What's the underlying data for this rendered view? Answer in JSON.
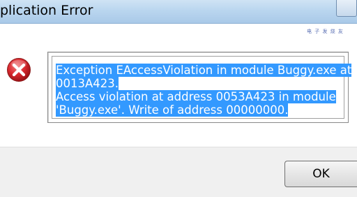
{
  "window": {
    "title": "plication Error",
    "close_icon": "close-icon"
  },
  "watermark": "电 子 发 烧 友",
  "dialog": {
    "icon": "error-icon",
    "message_lines": [
      "Exception EAccessViolation in module Buggy.exe at",
      "0013A423.",
      "Access violation at address 0053A423 in module",
      "'Buggy.exe'. Write of address 00000000."
    ],
    "ok_label": "OK"
  },
  "colors": {
    "selection": "#3399ff",
    "error_red": "#d9282e"
  }
}
